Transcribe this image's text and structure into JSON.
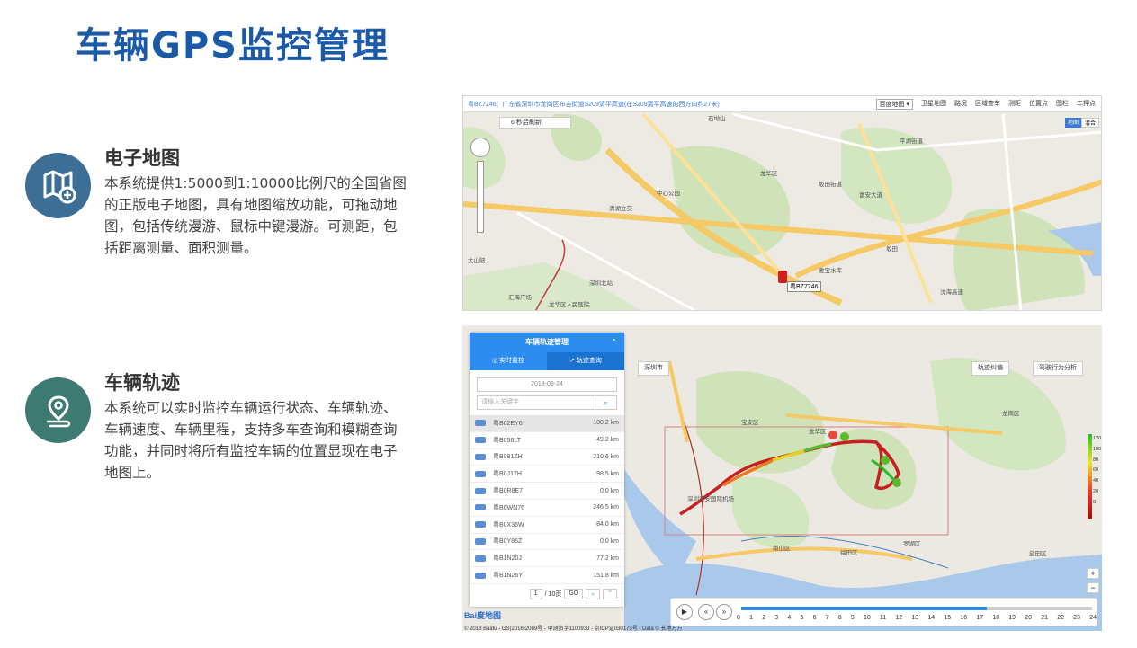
{
  "title": "车辆GPS监控管理",
  "features": [
    {
      "title": "电子地图",
      "desc": "本系统提供1:5000到1:10000比例尺的全国省图的正版电子地图，具有地图缩放功能，可拖动地图，包括传统漫游、鼠标中键漫游。可测距，包括距离测量、面积测量。",
      "color": "#3d6e96",
      "icon": "map-add-icon"
    },
    {
      "title": "车辆轨迹",
      "desc": "本系统可以实时监控车辆运行状态、车辆轨迹、车辆速度、车辆里程，支持多车查询和模糊查询功能，并同时将所有监控车辆的位置显现在电子地图上。",
      "color": "#3d7a72",
      "icon": "location-route-icon"
    }
  ],
  "map1": {
    "address": "粤BZ7246：广东省深圳市龙岗区布吉街道S209清平高速(在S209清平高速的西方向约27米)",
    "map_type": "百度地图 ▾",
    "tools": [
      "卫星地图",
      "路况",
      "区域查车",
      "测距",
      "位置点",
      "图栏",
      "二押点"
    ],
    "refresh": "6 秒后刷新",
    "vehicle": "粤BZ7246",
    "map_modes": [
      "地图",
      "混合"
    ],
    "place_labels": [
      "清湖立交",
      "龙华区",
      "石坳山",
      "富安大道",
      "平湖街道",
      "坂田街道",
      "中心公园",
      "龙岗路",
      "雅宝水库",
      "坂田",
      "大山陂",
      "汇海广场",
      "龙华区人民医院",
      "南头大道",
      "沈海高速",
      "深圳北站"
    ]
  },
  "map2": {
    "panel_title": "车辆轨迹管理",
    "tabs": [
      "实时监控",
      "轨迹查询"
    ],
    "date": "2018-08-24",
    "search_placeholder": "请输入关键字",
    "vehicles": [
      {
        "plate": "粤B02EY6",
        "dist": "100.2 km"
      },
      {
        "plate": "粤B058LT",
        "dist": "49.2 km"
      },
      {
        "plate": "粤B081ZH",
        "dist": "210.6 km"
      },
      {
        "plate": "粤B0J17H",
        "dist": "98.5 km"
      },
      {
        "plate": "粤B0R8E7",
        "dist": "0.0 km"
      },
      {
        "plate": "粤B0WN76",
        "dist": "246.5 km"
      },
      {
        "plate": "粤B0X36W",
        "dist": "84.0 km"
      },
      {
        "plate": "粤B0Y86Z",
        "dist": "0.0 km"
      },
      {
        "plate": "粤B1N20J",
        "dist": "77.2 km"
      },
      {
        "plate": "粤B1N26Y",
        "dist": "151.8 km"
      }
    ],
    "page_current": "1",
    "page_total": "/ 10页",
    "go": "GO",
    "city": "深圳市",
    "track_ctrl": "轨迹纠偏",
    "behavior_ctrl": "驾驶行为分析",
    "legend_ticks": [
      "120",
      "100",
      "80",
      "60",
      "40",
      "20",
      "0"
    ],
    "timeline_ticks": [
      "0",
      "1",
      "2",
      "3",
      "4",
      "5",
      "6",
      "7",
      "8",
      "9",
      "10",
      "11",
      "12",
      "13",
      "14",
      "15",
      "16",
      "17",
      "18",
      "19",
      "20",
      "21",
      "22",
      "23",
      "24"
    ],
    "timeline_progress": 0.7,
    "copyright": "© 2018 Baidu - GS(2016)2089号 - 甲测资字1100930 - 京ICP证030173号 - Data © 长地万方",
    "logo": "Bai度地图",
    "district_labels": [
      "龙华区",
      "深圳市",
      "南山区",
      "福田区",
      "罗湖区",
      "盐田区",
      "龙岗区",
      "宝安区",
      "深圳宝安国际机场"
    ]
  }
}
